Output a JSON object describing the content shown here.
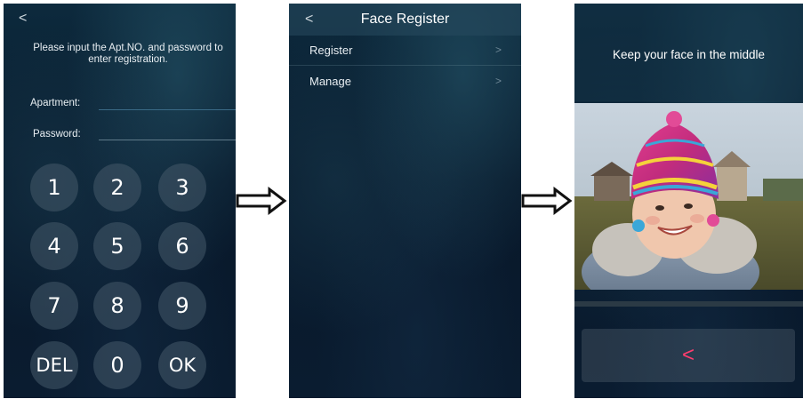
{
  "screen1": {
    "back_icon": "chevron-left-icon",
    "back_glyph": "<",
    "instruction": "Please input the Apt.NO. and password to enter registration.",
    "apartment_label": "Apartment:",
    "apartment_value": "",
    "password_label": "Password:",
    "password_value": "",
    "keypad": [
      [
        "1",
        "2",
        "3"
      ],
      [
        "4",
        "5",
        "6"
      ],
      [
        "7",
        "8",
        "9"
      ],
      [
        "DEL",
        "0",
        "OK"
      ]
    ]
  },
  "screen2": {
    "back_icon": "chevron-left-icon",
    "back_glyph": "<",
    "title": "Face Register",
    "menu": [
      {
        "label": "Register",
        "chevron": ">"
      },
      {
        "label": "Manage",
        "chevron": ">"
      }
    ]
  },
  "screen3": {
    "title": "Keep your face in the middle",
    "progress": 0.0,
    "back_icon": "chevron-left-icon",
    "back_glyph": "<",
    "back_color": "#ff3d6e"
  },
  "arrows": [
    "right-arrow-icon",
    "right-arrow-icon"
  ]
}
